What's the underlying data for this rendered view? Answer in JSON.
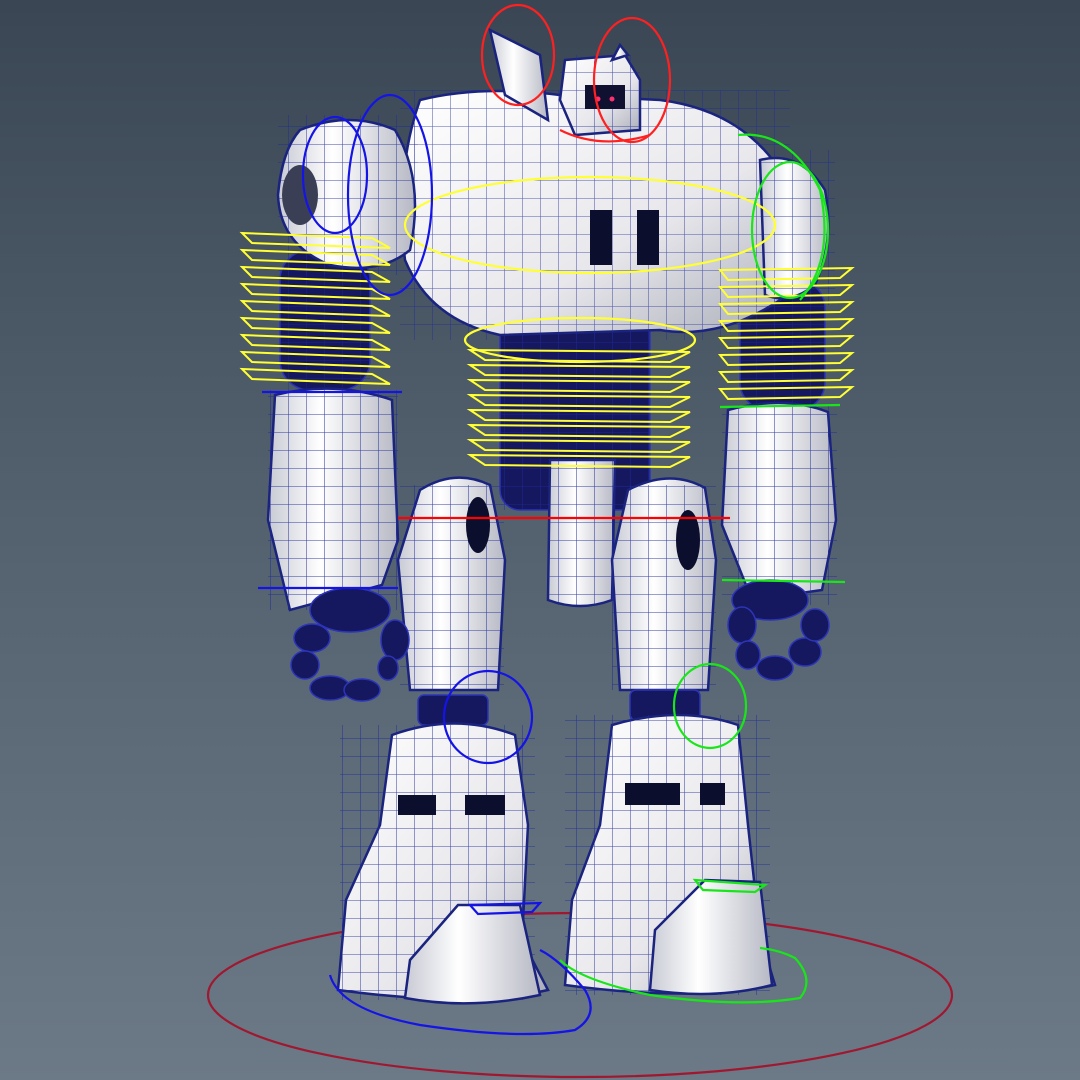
{
  "viewport": {
    "name": "maya-perspective-viewport",
    "background_top": "#3a4654",
    "background_bottom": "#6c7987"
  },
  "model": {
    "name": "robot-mech",
    "shading": "wireframe-on-shaded",
    "surface_color": "#f2f2f2",
    "wire_color": "#1a237e"
  },
  "rig_controls": {
    "colors": {
      "center": "#ffff33",
      "left": "#1414e6",
      "right": "#19e619",
      "head": "#ff2020",
      "root": "#a01830",
      "hip_line": "#ff0000"
    }
  }
}
